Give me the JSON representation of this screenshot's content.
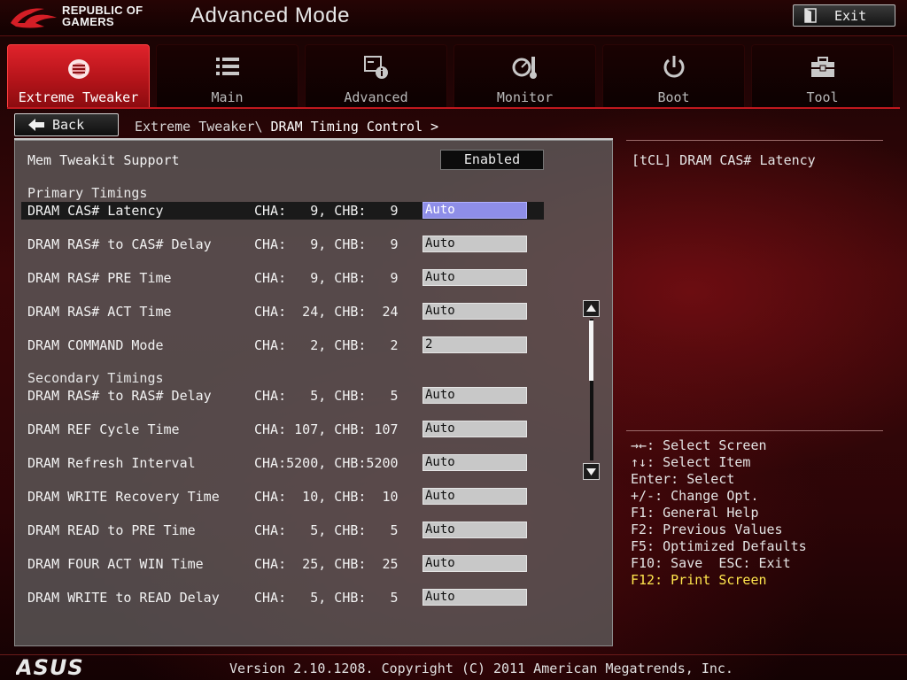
{
  "header": {
    "brand_line1": "REPUBLIC OF",
    "brand_line2": "GAMERS",
    "mode_title": "Advanced Mode",
    "exit_label": "Exit"
  },
  "tabs": [
    {
      "label": "Extreme Tweaker",
      "icon": "extreme-tweaker-icon",
      "active": true
    },
    {
      "label": "Main",
      "icon": "list-icon",
      "active": false
    },
    {
      "label": "Advanced",
      "icon": "advanced-settings-icon",
      "active": false
    },
    {
      "label": "Monitor",
      "icon": "monitor-gauge-icon",
      "active": false
    },
    {
      "label": "Boot",
      "icon": "power-icon",
      "active": false
    },
    {
      "label": "Tool",
      "icon": "toolbox-icon",
      "active": false
    }
  ],
  "breadcrumb": {
    "back_label": "Back",
    "path": "Extreme Tweaker\\ ",
    "current": "DRAM Timing Control >"
  },
  "settings": {
    "tweakit": {
      "name": "Mem Tweakit Support",
      "value": "Enabled"
    },
    "primary_heading": "Primary Timings",
    "primary": [
      {
        "name": "DRAM CAS# Latency",
        "cha": "CHA:   9, CHB:   9",
        "value": "Auto"
      },
      {
        "name": "DRAM RAS# to CAS# Delay",
        "cha": "CHA:   9, CHB:   9",
        "value": "Auto"
      },
      {
        "name": "DRAM RAS# PRE Time",
        "cha": "CHA:   9, CHB:   9",
        "value": "Auto"
      },
      {
        "name": "DRAM RAS# ACT Time",
        "cha": "CHA:  24, CHB:  24",
        "value": "Auto"
      },
      {
        "name": "DRAM COMMAND Mode",
        "cha": "CHA:   2, CHB:   2",
        "value": "2"
      }
    ],
    "secondary_heading": "Secondary Timings",
    "secondary": [
      {
        "name": "DRAM RAS# to RAS# Delay",
        "cha": "CHA:   5, CHB:   5",
        "value": "Auto"
      },
      {
        "name": "DRAM REF Cycle Time",
        "cha": "CHA: 107, CHB: 107",
        "value": "Auto"
      },
      {
        "name": "DRAM Refresh Interval",
        "cha": "CHA:5200, CHB:5200",
        "value": "Auto"
      },
      {
        "name": "DRAM WRITE Recovery Time",
        "cha": "CHA:  10, CHB:  10",
        "value": "Auto"
      },
      {
        "name": "DRAM READ to PRE Time",
        "cha": "CHA:   5, CHB:   5",
        "value": "Auto"
      },
      {
        "name": "DRAM FOUR ACT WIN Time",
        "cha": "CHA:  25, CHB:  25",
        "value": "Auto"
      },
      {
        "name": "DRAM WRITE to READ Delay",
        "cha": "CHA:   5, CHB:   5",
        "value": "Auto"
      }
    ]
  },
  "help": {
    "title": "[tCL] DRAM CAS# Latency",
    "keys": [
      "→←: Select Screen",
      "↑↓: Select Item",
      "Enter: Select",
      "+/-: Change Opt.",
      "F1: General Help",
      "F2: Previous Values",
      "F5: Optimized Defaults",
      "F10: Save  ESC: Exit",
      "F12: Print Screen"
    ]
  },
  "footer": {
    "logo_text": "ASUS",
    "version": "Version 2.10.1208. Copyright (C) 2011 American Megatrends, Inc."
  },
  "colors": {
    "accent_red": "#d41e26",
    "selected_value": "#8e8ee8",
    "highlight_key": "#ffe64d"
  }
}
